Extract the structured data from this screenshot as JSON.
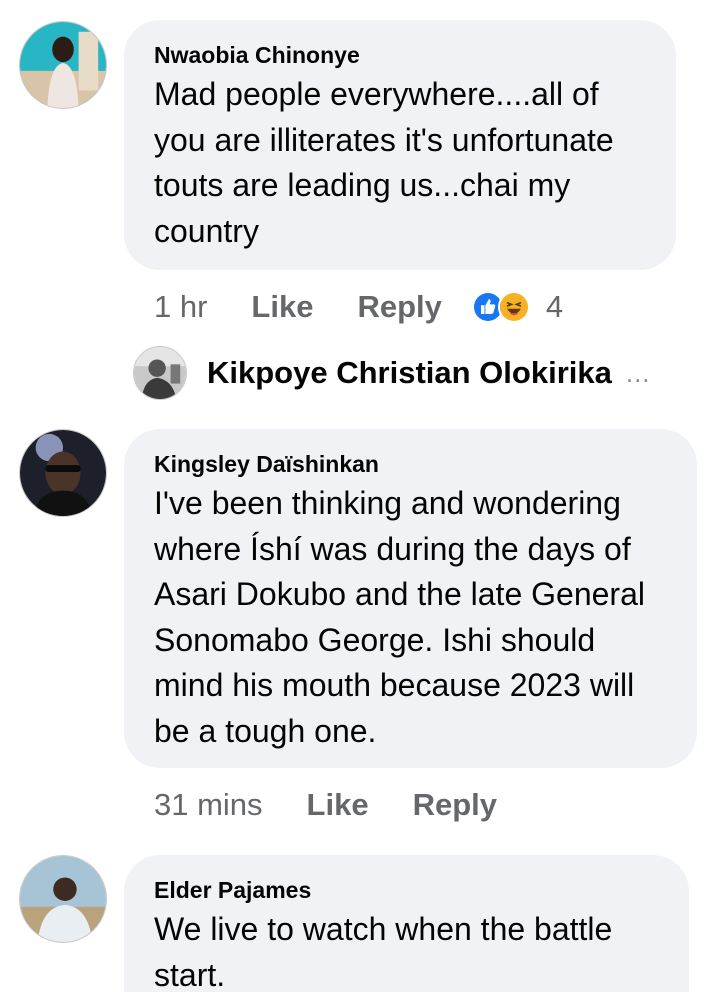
{
  "comments": [
    {
      "author": "Nwaobia Chinonye",
      "text": "Mad people everywhere....all of\nyou are illiterates it's unfortunate\ntouts are leading us...chai my\ncountry",
      "time": "1 hr",
      "like_label": "Like",
      "reply_label": "Reply",
      "reactions": [
        "like-reaction-icon",
        "haha-reaction-icon"
      ],
      "reaction_count": "4"
    },
    {
      "author": "Kingsley Daïshinkan",
      "text": "I've been thinking  and wondering\nwhere Íshí was during the days of\nAsari Dokubo and the late General\nSonomabo George. Ishi should\nmind his mouth because 2023 will\nbe a tough one.",
      "time": "31 mins",
      "like_label": "Like",
      "reply_label": "Reply"
    },
    {
      "author": "Elder Pajames",
      "text": "We live to watch when the battle\nstart."
    }
  ],
  "reply_preview": {
    "author": "Kikpoye Christian Olokirika",
    "more": "..."
  },
  "colors": {
    "bubble": "#f0f2f5",
    "meta_text": "#65676b",
    "like_blue": "#1877f2",
    "haha_yellow": "#f7b125"
  }
}
